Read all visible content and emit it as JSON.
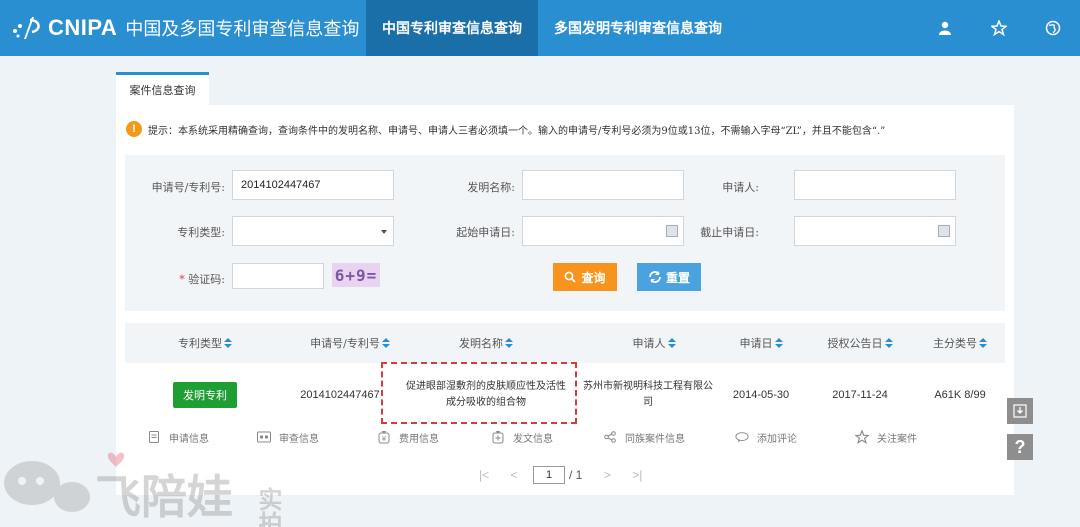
{
  "header": {
    "brand": "CNIPA",
    "brand_sub": "中国及多国专利审查信息查询",
    "tabs": [
      {
        "label": "中国专利审查信息查询",
        "active": true
      },
      {
        "label": "多国发明专利审查信息查询",
        "active": false
      }
    ],
    "icons": [
      "user-icon",
      "star-icon",
      "globe-icon"
    ],
    "color": "#2a8fd1",
    "active_color": "#1a6fa8"
  },
  "page_tab": "案件信息查询",
  "notice": "提示：本系统采用精确查询，查询条件中的发明名称、申请号、申请人三者必须填一个。输入的申请号/专利号必须为9位或13位，不需输入字母“ZL”，并且不能包含“.”",
  "form": {
    "app_no_label": "申请号/专利号:",
    "app_no_value": "2014102447467",
    "title_label": "发明名称:",
    "title_value": "",
    "applicant_label": "申请人:",
    "applicant_value": "",
    "type_label": "专利类型:",
    "type_value": "",
    "start_label": "起始申请日:",
    "start_value": "",
    "end_label": "截止申请日:",
    "end_value": "",
    "captcha_label": "验证码:",
    "captcha_req": "*",
    "captcha_value": "",
    "captcha_image": "6+9=",
    "search_label": "查询",
    "reset_label": "重置"
  },
  "table": {
    "headers": [
      "专利类型",
      "申请号/专利号",
      "发明名称",
      "申请人",
      "申请日",
      "授权公告日",
      "主分类号"
    ],
    "row": {
      "type": "发明专利",
      "app_no": "2014102447467",
      "title_line1": "促进眼部湿敷剂的皮肤顺应性及活性",
      "title_line2": "成分吸收的组合物",
      "applicant_line1": "苏州市新视明科技工程有限公",
      "applicant_line2": "司",
      "app_date": "2014-05-30",
      "grant_date": "2017-11-24",
      "ipc": "A61K 8/99"
    },
    "actions": [
      "申请信息",
      "审查信息",
      "费用信息",
      "发文信息",
      "同族案件信息",
      "添加评论",
      "关注案件"
    ]
  },
  "pager": {
    "first": "|<",
    "prev": "<",
    "current": "1",
    "total": "/ 1",
    "next": ">",
    "last": ">|"
  },
  "side": {
    "download_icon": "download-icon",
    "help": "?"
  },
  "watermark": {
    "text": "飞陪娃",
    "sub": "实拍"
  }
}
